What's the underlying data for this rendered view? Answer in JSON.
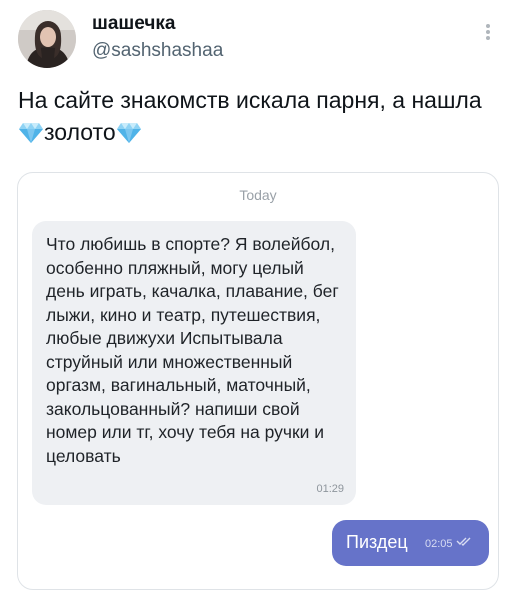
{
  "tweet": {
    "display_name": "шашечка",
    "handle": "@sashshashaa",
    "text_part1": "На сайте знакомств искала парня, а нашла ",
    "text_part2": "золото",
    "icons": {
      "avatar": "profile-photo",
      "more": "vertical-ellipsis-icon",
      "emoji": "gem-stone-emoji"
    }
  },
  "chat": {
    "date_label": "Today",
    "incoming": {
      "text": "Что любишь в спорте? Я волейбол, особенно пляжный, могу целый день играть, качалка, плавание, бег лыжи, кино и театр, путешествия, любые движухи Испытывала струйный или множественный оргазм, вагинальный, маточный, закольцованный? напиши свой номер или тг, хочу тебя на ручки и целовать",
      "time": "01:29"
    },
    "outgoing": {
      "text": "Пиздец",
      "time": "02:05",
      "status_icon": "double-check-icon"
    }
  },
  "colors": {
    "outgoing_bubble": "#6673c9",
    "incoming_bubble": "#eef0f3",
    "handle_text": "#536471"
  }
}
